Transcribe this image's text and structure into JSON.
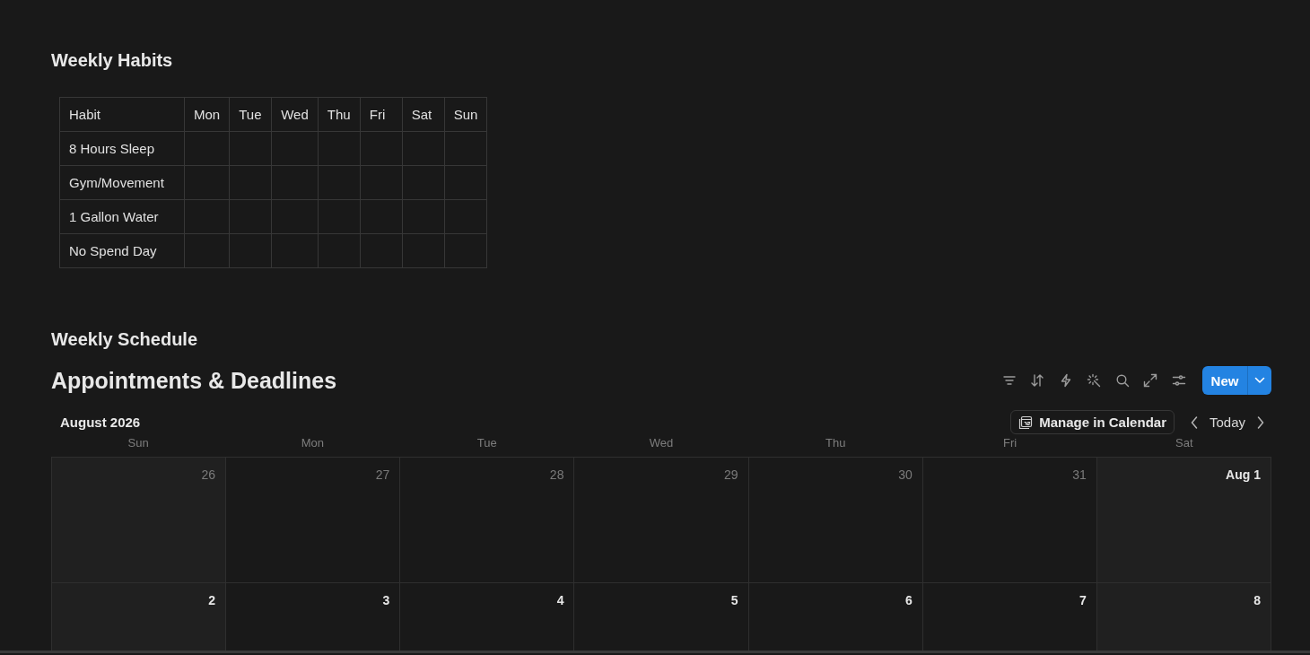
{
  "habits": {
    "title": "Weekly Habits",
    "columns": [
      "Habit",
      "Mon",
      "Tue",
      "Wed",
      "Thu",
      "Fri",
      "Sat",
      "Sun"
    ],
    "rows": [
      "8 Hours Sleep",
      "Gym/Movement",
      "1 Gallon Water",
      "No Spend Day"
    ]
  },
  "schedule": {
    "title": "Weekly Schedule"
  },
  "calendar": {
    "title": "Appointments & Deadlines",
    "new_button": "New",
    "month": "August 2026",
    "manage_button": "Manage in Calendar",
    "today_button": "Today",
    "weekdays": [
      "Sun",
      "Mon",
      "Tue",
      "Wed",
      "Thu",
      "Fri",
      "Sat"
    ],
    "weeks": [
      [
        {
          "day": "26",
          "in_month": false
        },
        {
          "day": "27",
          "in_month": false
        },
        {
          "day": "28",
          "in_month": false
        },
        {
          "day": "29",
          "in_month": false
        },
        {
          "day": "30",
          "in_month": false
        },
        {
          "day": "31",
          "in_month": false
        },
        {
          "day": "Aug 1",
          "in_month": true
        }
      ],
      [
        {
          "day": "2",
          "in_month": true
        },
        {
          "day": "3",
          "in_month": true
        },
        {
          "day": "4",
          "in_month": true
        },
        {
          "day": "5",
          "in_month": true
        },
        {
          "day": "6",
          "in_month": true
        },
        {
          "day": "7",
          "in_month": true
        },
        {
          "day": "8",
          "in_month": true
        }
      ]
    ]
  }
}
